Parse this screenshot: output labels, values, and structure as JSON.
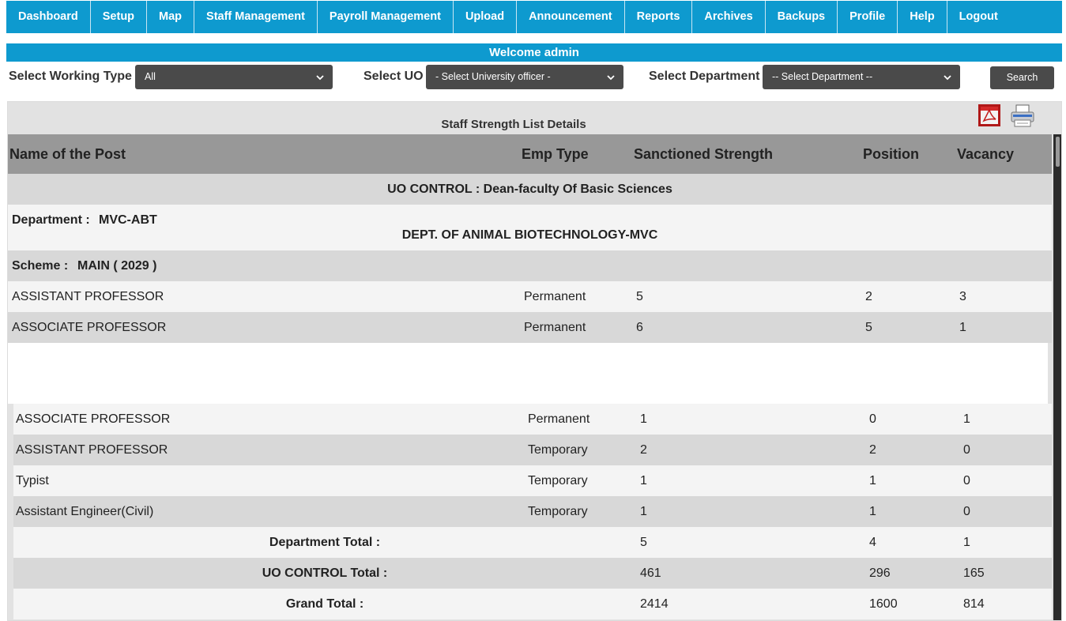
{
  "nav": {
    "items": [
      {
        "label": "Dashboard"
      },
      {
        "label": "Setup"
      },
      {
        "label": "Map"
      },
      {
        "label": "Staff Management"
      },
      {
        "label": "Payroll Management"
      },
      {
        "label": "Upload"
      },
      {
        "label": "Announcement"
      },
      {
        "label": "Reports"
      },
      {
        "label": "Archives"
      },
      {
        "label": "Backups"
      },
      {
        "label": "Profile"
      },
      {
        "label": "Help"
      },
      {
        "label": "Logout"
      }
    ]
  },
  "welcome": "Welcome admin",
  "filters": {
    "working_type_label": "Select Working Type",
    "working_type_value": "All",
    "uo_label": "Select UO",
    "uo_value": "- Select University officer -",
    "department_label": "Select Department",
    "department_value": "-- Select Department --",
    "search_label": "Search"
  },
  "panel": {
    "title": "Staff Strength List Details",
    "icons": [
      "pdf-icon",
      "printer-icon"
    ]
  },
  "table": {
    "headers": {
      "post": "Name of the Post",
      "emp_type": "Emp Type",
      "sanctioned": "Sanctioned Strength",
      "position": "Position",
      "vacancy": "Vacancy"
    },
    "uo_control_label": "UO CONTROL : Dean-faculty Of Basic Sciences",
    "department_prefix": "Department :",
    "department_code": "MVC-ABT",
    "department_name": "DEPT. OF ANIMAL BIOTECHNOLOGY-MVC",
    "scheme_prefix": "Scheme :",
    "scheme_value": "MAIN ( 2029 )",
    "rows_top": [
      {
        "post": "ASSISTANT PROFESSOR",
        "emp_type": "Permanent",
        "sanctioned": "5",
        "position": "2",
        "vacancy": "3"
      },
      {
        "post": "ASSOCIATE PROFESSOR",
        "emp_type": "Permanent",
        "sanctioned": "6",
        "position": "5",
        "vacancy": "1"
      }
    ],
    "rows_bottom": [
      {
        "post": "ASSOCIATE PROFESSOR",
        "emp_type": "Permanent",
        "sanctioned": "1",
        "position": "0",
        "vacancy": "1"
      },
      {
        "post": "ASSISTANT PROFESSOR",
        "emp_type": "Temporary",
        "sanctioned": "2",
        "position": "2",
        "vacancy": "0"
      },
      {
        "post": "Typist",
        "emp_type": "Temporary",
        "sanctioned": "1",
        "position": "1",
        "vacancy": "0"
      },
      {
        "post": "Assistant Engineer(Civil)",
        "emp_type": "Temporary",
        "sanctioned": "1",
        "position": "1",
        "vacancy": "0"
      }
    ],
    "totals": [
      {
        "label": "Department Total :",
        "sanctioned": "5",
        "position": "4",
        "vacancy": "1"
      },
      {
        "label": "UO CONTROL Total :",
        "sanctioned": "461",
        "position": "296",
        "vacancy": "165"
      },
      {
        "label": "Grand Total :",
        "sanctioned": "2414",
        "position": "1600",
        "vacancy": "814"
      }
    ]
  },
  "colors": {
    "nav_bg": "#0e9acf",
    "select_bg": "#4a4a4a",
    "header_bg": "#989898",
    "row_light": "#f4f4f4",
    "row_dark": "#d8d8d8"
  }
}
